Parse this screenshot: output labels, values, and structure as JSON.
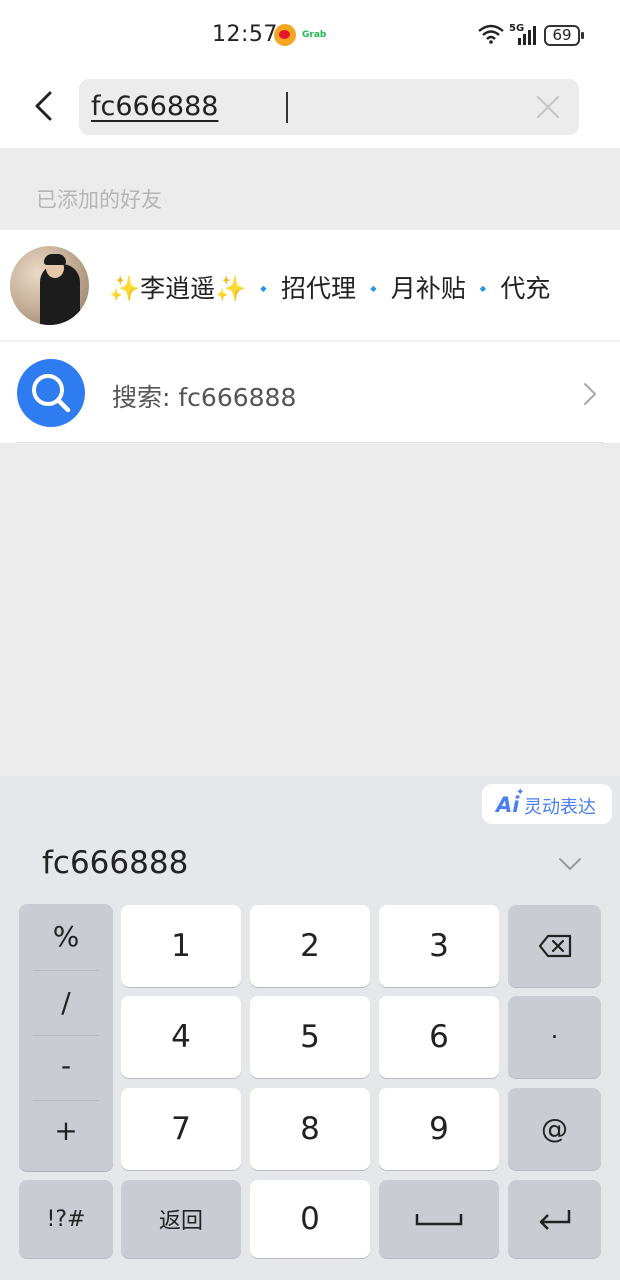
{
  "status_bar": {
    "time": "12:57",
    "grab_label": "Grab",
    "signal_label": "5G",
    "battery": "69"
  },
  "search": {
    "query": "fc666888"
  },
  "section": {
    "label": "已添加的好友"
  },
  "friend": {
    "name_parts": [
      "✨",
      "李逍遥",
      "✨",
      "🔹",
      "招代理",
      "🔹",
      "月补贴",
      "🔹",
      "代充"
    ]
  },
  "search_row": {
    "label": "搜索: fc666888"
  },
  "keyboard": {
    "ai_mark": "Ai",
    "ai_label": "灵动表达",
    "candidate": "fc666888",
    "symbols": [
      "%",
      "/",
      "-",
      "+"
    ],
    "digits": [
      "1",
      "2",
      "3",
      "4",
      "5",
      "6",
      "7",
      "8",
      "9",
      "0"
    ],
    "dot_key": "·",
    "at_key": "@",
    "punct_key": "!?#",
    "back_key": "返回"
  }
}
